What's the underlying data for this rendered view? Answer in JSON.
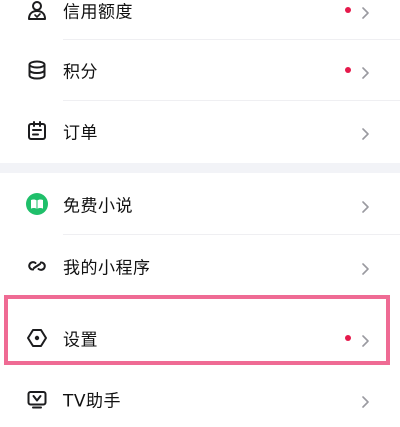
{
  "colors": {
    "accent_dot": "#e5194b",
    "chevron": "#9a9aa0",
    "icon": "#1c1c1e",
    "novel_icon_bg": "#1fbf6a",
    "highlight_border": "#ef6b94"
  },
  "menu": {
    "items": [
      {
        "label": "信用额度",
        "icon": "credit-limit-icon",
        "has_dot": true
      },
      {
        "label": "积分",
        "icon": "coin-stack-icon",
        "has_dot": true
      },
      {
        "label": "订单",
        "icon": "order-icon",
        "has_dot": false
      },
      {
        "label": "免费小说",
        "icon": "book-icon",
        "has_dot": false
      },
      {
        "label": "我的小程序",
        "icon": "mini-program-icon",
        "has_dot": false
      },
      {
        "label": "设置",
        "icon": "settings-icon",
        "has_dot": true,
        "highlighted": true
      },
      {
        "label": "TV助手",
        "icon": "tv-icon",
        "has_dot": false
      }
    ]
  }
}
